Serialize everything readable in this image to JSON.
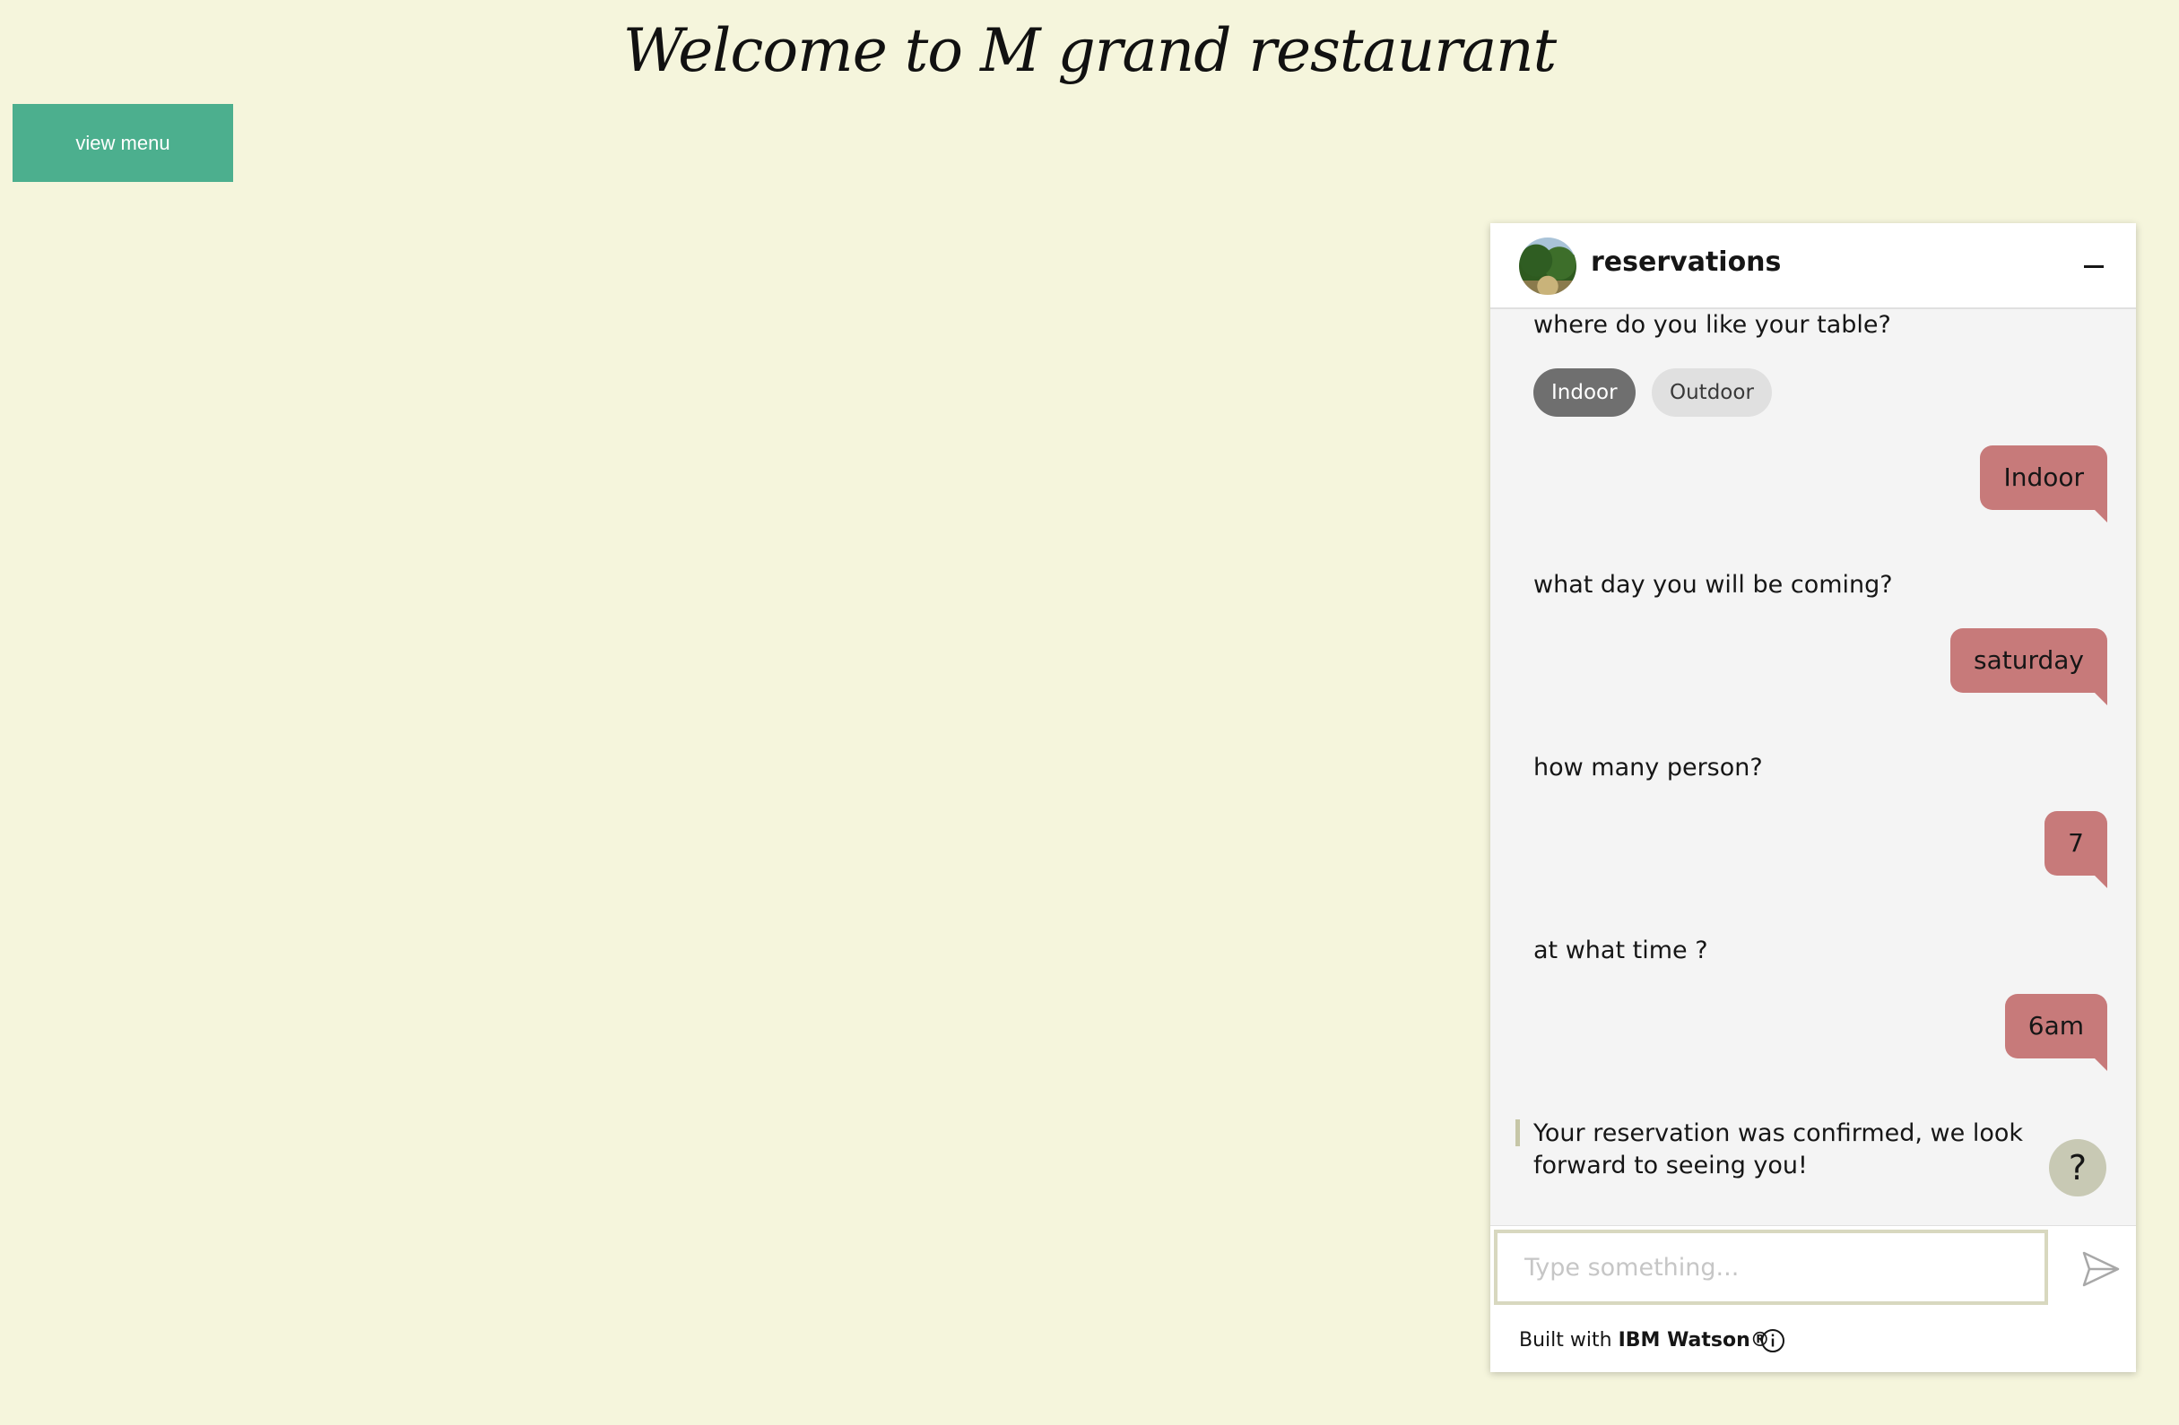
{
  "page": {
    "title": "Welcome to M grand restaurant",
    "view_menu_label": "view menu"
  },
  "chat": {
    "title": "reservations",
    "messages": {
      "q_table": "where do you like your table?",
      "option_indoor": "Indoor",
      "option_outdoor": "Outdoor",
      "a_table": "Indoor",
      "q_day": "what day you will be coming?",
      "a_day": "saturday",
      "q_persons": "how many person?",
      "a_persons": "7",
      "q_time": "at what time ?",
      "a_time": "6am",
      "confirmation": "Your reservation was confirmed, we look forward to seeing you!"
    },
    "help_label": "?",
    "input_placeholder": "Type something...",
    "footer_prefix": "Built with ",
    "footer_brand": "IBM Watson®"
  },
  "colors": {
    "background": "#f5f5dc",
    "button": "#4caf8e",
    "user_bubble": "#c77a7a",
    "help_button": "#c8c9b4"
  },
  "icons": {
    "minimize": "minus-icon",
    "send": "send-icon",
    "info": "info-icon",
    "avatar": "garden-avatar"
  }
}
